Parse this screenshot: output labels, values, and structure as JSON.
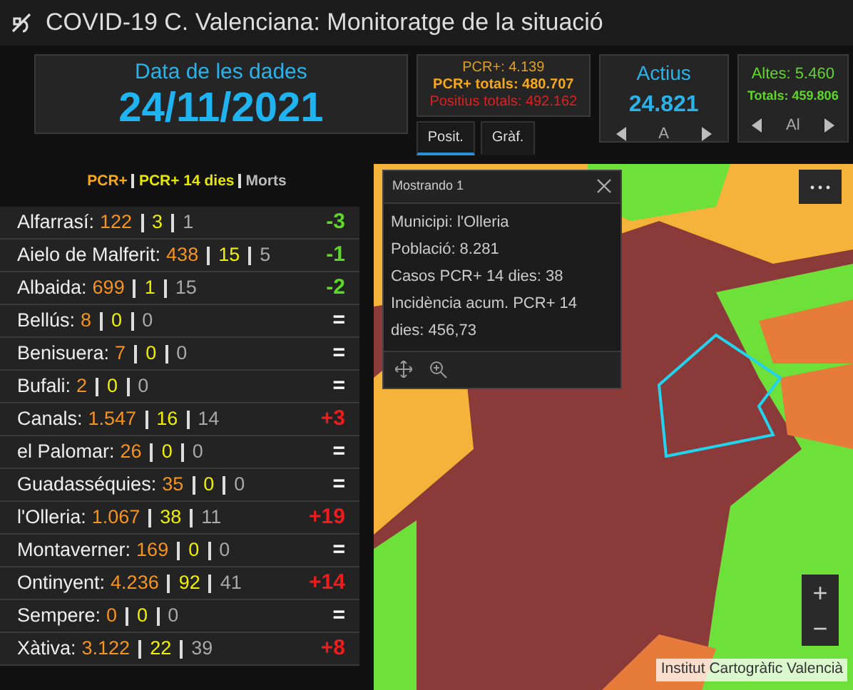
{
  "window": {
    "title": "COVID-19 C. Valenciana: Monitoratge de la situació"
  },
  "date_card": {
    "label": "Data de les dades",
    "value": "24/11/2021"
  },
  "positives_card": {
    "lines": [
      {
        "kind": "daily",
        "text": "PCR+: 4.139"
      },
      {
        "kind": "total",
        "text": "PCR+ totals: 480.707"
      },
      {
        "kind": "positives",
        "text": "Positius totals: 492.162"
      }
    ],
    "tabs": [
      {
        "label": "Posit.",
        "selected": true
      },
      {
        "label": "Gràf.",
        "selected": false
      }
    ]
  },
  "active_card": {
    "label": "Actius",
    "value": "24.821",
    "pager": "A"
  },
  "discharges_card": {
    "lines": [
      {
        "kind": "daily",
        "text": "Altes: 5.460"
      },
      {
        "kind": "total",
        "text": "Totals: 459.806"
      }
    ],
    "pager": "Al"
  },
  "legend": [
    "PCR+",
    "PCR+ 14 dies",
    "Morts"
  ],
  "municipalities": [
    {
      "name": "Alfarrasí:",
      "pcr": "122",
      "pcr14": "3",
      "deaths": "1",
      "change": "-3",
      "color": "#5fd62a"
    },
    {
      "name": "Aielo de Malferit:",
      "pcr": "438",
      "pcr14": "15",
      "deaths": "5",
      "change": "-1",
      "color": "#5fd62a"
    },
    {
      "name": "Albaida:",
      "pcr": "699",
      "pcr14": "1",
      "deaths": "15",
      "change": "-2",
      "color": "#5fd62a"
    },
    {
      "name": "Bellús:",
      "pcr": "8",
      "pcr14": "0",
      "deaths": "0",
      "change": "=",
      "color": "#ffffff"
    },
    {
      "name": "Benisuera:",
      "pcr": "7",
      "pcr14": "0",
      "deaths": "0",
      "change": "=",
      "color": "#ffffff"
    },
    {
      "name": "Bufali:",
      "pcr": "2",
      "pcr14": "0",
      "deaths": "0",
      "change": "=",
      "color": "#ffffff"
    },
    {
      "name": "Canals:",
      "pcr": "1.547",
      "pcr14": "16",
      "deaths": "14",
      "change": "+3",
      "color": "#ee1c1c"
    },
    {
      "name": "el Palomar:",
      "pcr": "26",
      "pcr14": "0",
      "deaths": "0",
      "change": "=",
      "color": "#ffffff"
    },
    {
      "name": "Guadasséquies:",
      "pcr": "35",
      "pcr14": "0",
      "deaths": "0",
      "change": "=",
      "color": "#ffffff"
    },
    {
      "name": "l'Olleria:",
      "pcr": "1.067",
      "pcr14": "38",
      "deaths": "11",
      "change": "+19",
      "color": "#ee1c1c"
    },
    {
      "name": "Montaverner:",
      "pcr": "169",
      "pcr14": "0",
      "deaths": "0",
      "change": "=",
      "color": "#ffffff"
    },
    {
      "name": "Ontinyent:",
      "pcr": "4.236",
      "pcr14": "92",
      "deaths": "41",
      "change": "+14",
      "color": "#ee1c1c"
    },
    {
      "name": "Sempere:",
      "pcr": "0",
      "pcr14": "0",
      "deaths": "0",
      "change": "=",
      "color": "#ffffff"
    },
    {
      "name": "Xàtiva:",
      "pcr": "3.122",
      "pcr14": "22",
      "deaths": "39",
      "change": "+8",
      "color": "#ee1c1c"
    }
  ],
  "map": {
    "popup": {
      "title": "Mostrando 1",
      "lines": [
        "Municipi: l'Olleria",
        "Població: 8.281",
        "Casos PCR+ 14 dies: 38",
        "Incidència acum. PCR+ 14 dies: 456,73"
      ]
    },
    "zoom_in": "+",
    "zoom_out": "−",
    "attribution": "Institut Cartogràfic Valencià"
  }
}
